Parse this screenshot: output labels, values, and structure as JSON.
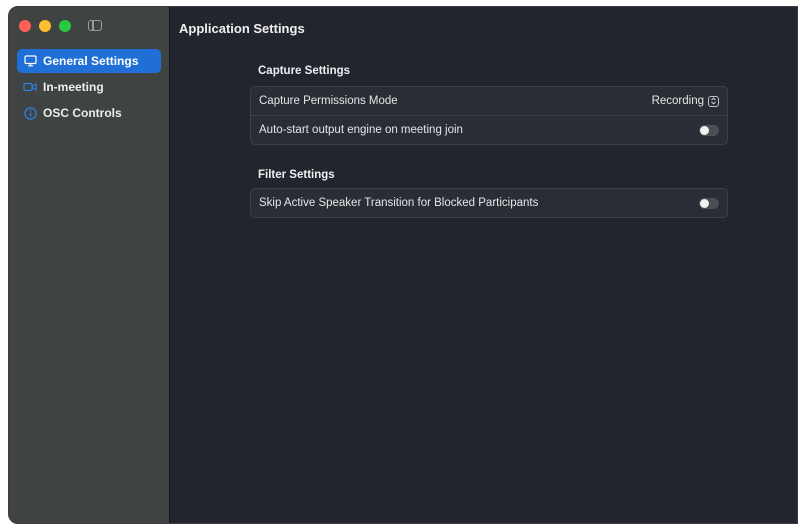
{
  "window": {
    "title": "Application Settings"
  },
  "sidebar": {
    "items": [
      {
        "label": "General Settings",
        "icon": "monitor-icon",
        "active": true
      },
      {
        "label": "In-meeting",
        "icon": "video-camera-icon",
        "active": false
      },
      {
        "label": "OSC Controls",
        "icon": "info-icon",
        "active": false
      }
    ]
  },
  "main": {
    "sections": [
      {
        "title": "Capture Settings",
        "rows": [
          {
            "label": "Capture Permissions Mode",
            "control": "select",
            "value": "Recording"
          },
          {
            "label": "Auto-start output engine on meeting join",
            "control": "toggle",
            "on": false
          }
        ]
      },
      {
        "title": "Filter Settings",
        "rows": [
          {
            "label": "Skip Active Speaker Transition for Blocked Participants",
            "control": "toggle",
            "on": false
          }
        ]
      }
    ]
  },
  "colors": {
    "accent": "#1f6fd6",
    "sidebar_bg": "#3f4442",
    "content_bg": "#22252e"
  }
}
